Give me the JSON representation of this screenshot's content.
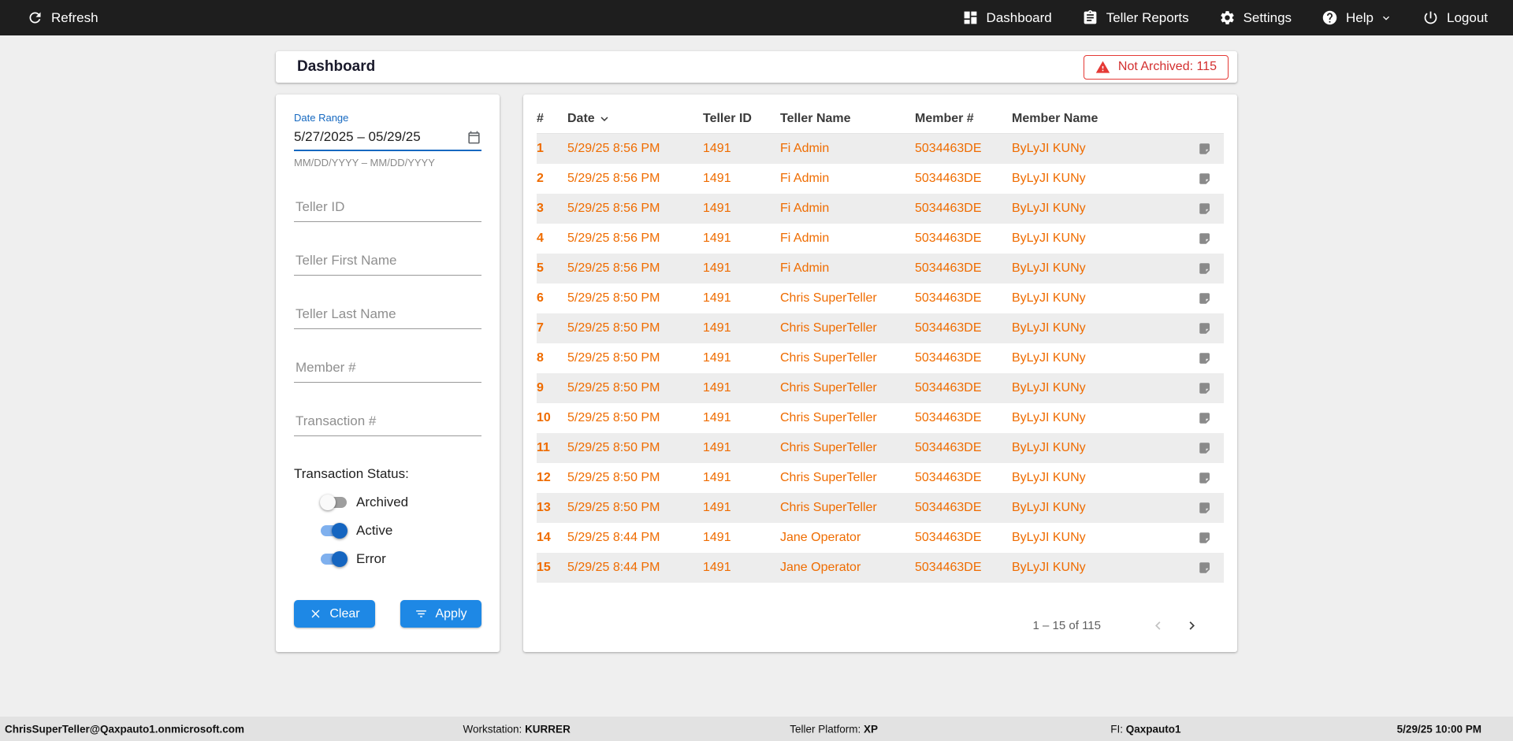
{
  "topbar": {
    "refresh_label": "Refresh",
    "items": [
      {
        "label": "Dashboard"
      },
      {
        "label": "Teller Reports"
      },
      {
        "label": "Settings"
      },
      {
        "label": "Help"
      },
      {
        "label": "Logout"
      }
    ]
  },
  "header": {
    "title": "Dashboard",
    "badge_label": "Not Archived: 115"
  },
  "filters": {
    "date_range_label": "Date Range",
    "date_range_value": "5/27/2025 – 05/29/25",
    "date_range_hint": "MM/DD/YYYY – MM/DD/YYYY",
    "fields": [
      {
        "placeholder": "Teller ID"
      },
      {
        "placeholder": "Teller First Name"
      },
      {
        "placeholder": "Teller Last Name"
      },
      {
        "placeholder": "Member #"
      },
      {
        "placeholder": "Transaction #"
      }
    ],
    "status_label": "Transaction Status:",
    "toggles": [
      {
        "label": "Archived",
        "on": false
      },
      {
        "label": "Active",
        "on": true
      },
      {
        "label": "Error",
        "on": true
      }
    ],
    "clear_label": "Clear",
    "apply_label": "Apply"
  },
  "table": {
    "columns": {
      "num": "#",
      "date": "Date",
      "teller_id": "Teller ID",
      "teller_name": "Teller Name",
      "member_num": "Member #",
      "member_name": "Member Name"
    },
    "rows": [
      {
        "num": "1",
        "date": "5/29/25 8:56 PM",
        "teller_id": "1491",
        "teller_name": "Fi Admin",
        "member_num": "5034463DE",
        "member_name": "ByLyJI KUNy"
      },
      {
        "num": "2",
        "date": "5/29/25 8:56 PM",
        "teller_id": "1491",
        "teller_name": "Fi Admin",
        "member_num": "5034463DE",
        "member_name": "ByLyJI KUNy"
      },
      {
        "num": "3",
        "date": "5/29/25 8:56 PM",
        "teller_id": "1491",
        "teller_name": "Fi Admin",
        "member_num": "5034463DE",
        "member_name": "ByLyJI KUNy"
      },
      {
        "num": "4",
        "date": "5/29/25 8:56 PM",
        "teller_id": "1491",
        "teller_name": "Fi Admin",
        "member_num": "5034463DE",
        "member_name": "ByLyJI KUNy"
      },
      {
        "num": "5",
        "date": "5/29/25 8:56 PM",
        "teller_id": "1491",
        "teller_name": "Fi Admin",
        "member_num": "5034463DE",
        "member_name": "ByLyJI KUNy"
      },
      {
        "num": "6",
        "date": "5/29/25 8:50 PM",
        "teller_id": "1491",
        "teller_name": "Chris SuperTeller",
        "member_num": "5034463DE",
        "member_name": "ByLyJI KUNy"
      },
      {
        "num": "7",
        "date": "5/29/25 8:50 PM",
        "teller_id": "1491",
        "teller_name": "Chris SuperTeller",
        "member_num": "5034463DE",
        "member_name": "ByLyJI KUNy"
      },
      {
        "num": "8",
        "date": "5/29/25 8:50 PM",
        "teller_id": "1491",
        "teller_name": "Chris SuperTeller",
        "member_num": "5034463DE",
        "member_name": "ByLyJI KUNy"
      },
      {
        "num": "9",
        "date": "5/29/25 8:50 PM",
        "teller_id": "1491",
        "teller_name": "Chris SuperTeller",
        "member_num": "5034463DE",
        "member_name": "ByLyJI KUNy"
      },
      {
        "num": "10",
        "date": "5/29/25 8:50 PM",
        "teller_id": "1491",
        "teller_name": "Chris SuperTeller",
        "member_num": "5034463DE",
        "member_name": "ByLyJI KUNy"
      },
      {
        "num": "11",
        "date": "5/29/25 8:50 PM",
        "teller_id": "1491",
        "teller_name": "Chris SuperTeller",
        "member_num": "5034463DE",
        "member_name": "ByLyJI KUNy"
      },
      {
        "num": "12",
        "date": "5/29/25 8:50 PM",
        "teller_id": "1491",
        "teller_name": "Chris SuperTeller",
        "member_num": "5034463DE",
        "member_name": "ByLyJI KUNy"
      },
      {
        "num": "13",
        "date": "5/29/25 8:50 PM",
        "teller_id": "1491",
        "teller_name": "Chris SuperTeller",
        "member_num": "5034463DE",
        "member_name": "ByLyJI KUNy"
      },
      {
        "num": "14",
        "date": "5/29/25 8:44 PM",
        "teller_id": "1491",
        "teller_name": "Jane Operator",
        "member_num": "5034463DE",
        "member_name": "ByLyJI KUNy"
      },
      {
        "num": "15",
        "date": "5/29/25 8:44 PM",
        "teller_id": "1491",
        "teller_name": "Jane Operator",
        "member_num": "5034463DE",
        "member_name": "ByLyJI KUNy"
      }
    ],
    "pagination_label": "1 – 15 of 115"
  },
  "statusbar": {
    "user": "ChrisSuperTeller@Qaxpauto1.onmicrosoft.com",
    "workstation_label": "Workstation:",
    "workstation_value": "KURRER",
    "platform_label": "Teller Platform:",
    "platform_value": "XP",
    "fi_label": "FI:",
    "fi_value": "Qaxpauto1",
    "time": "5/29/25 10:00 PM"
  },
  "colors": {
    "topbar_bg": "#1e1e1e",
    "accent_blue": "#1e88e5",
    "row_text_orange": "#ef6c00",
    "alert_red": "#d32f2f"
  }
}
